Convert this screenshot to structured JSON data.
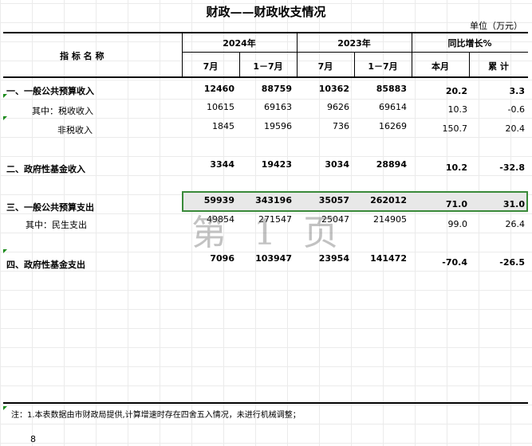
{
  "sheet": {
    "title": "财政——财政收支情况",
    "unit": "单位（万元）",
    "header": {
      "indicator": "指 标 名 称",
      "year_2024": "2024年",
      "year_2023": "2023年",
      "yoy": "同比增长%",
      "month": "7月",
      "cumulative": "1－7月",
      "this_month": "本月",
      "accumulated": "累 计"
    },
    "rows": [
      {
        "label": "一、一般公共预算收入",
        "v1": "12460",
        "v2": "88759",
        "v3": "10362",
        "v4": "85883",
        "v5": "20.2",
        "v6": "3.3"
      },
      {
        "label": "其中：税收收入",
        "v1": "10615",
        "v2": "69163",
        "v3": "9626",
        "v4": "69614",
        "v5": "10.3",
        "v6": "-0.6"
      },
      {
        "label": "非税收入",
        "v1": "1845",
        "v2": "19596",
        "v3": "736",
        "v4": "16269",
        "v5": "150.7",
        "v6": "20.4"
      },
      {
        "label": "二、政府性基金收入",
        "v1": "3344",
        "v2": "19423",
        "v3": "3034",
        "v4": "28894",
        "v5": "10.2",
        "v6": "-32.8"
      },
      {
        "label": "三、一般公共预算支出",
        "v1": "59939",
        "v2": "343196",
        "v3": "35057",
        "v4": "262012",
        "v5": "71.0",
        "v6": "31.0"
      },
      {
        "label": "其中：民生支出",
        "v1": "49854",
        "v2": "271547",
        "v3": "25047",
        "v4": "214905",
        "v5": "99.0",
        "v6": "26.4"
      },
      {
        "label": "四、政府性基金支出",
        "v1": "7096",
        "v2": "103947",
        "v3": "23954",
        "v4": "141472",
        "v5": "-70.4",
        "v6": "-26.5"
      }
    ],
    "watermark": "第 1 页",
    "note": "注：1.本表数据由市财政局提供,计算增速时存在四舍五入情况，未进行机械调整；",
    "page_number": "8"
  },
  "colors": {
    "selection": "#3a8a3a",
    "marker": "#1a8a1a"
  }
}
